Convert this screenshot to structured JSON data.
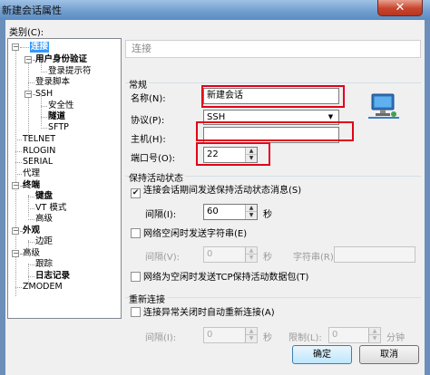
{
  "window": {
    "title": "新建会话属性",
    "close_glyph": "✕"
  },
  "category_label": "类别(C):",
  "tree": {
    "items": [
      {
        "label": "连接",
        "bold": true,
        "selected": true
      },
      {
        "label": "用户身份验证",
        "bold": true
      },
      {
        "label": "登录提示符"
      },
      {
        "label": "登录脚本"
      },
      {
        "label": "SSH"
      },
      {
        "label": "安全性"
      },
      {
        "label": "隧道",
        "bold": true
      },
      {
        "label": "SFTP"
      },
      {
        "label": "TELNET"
      },
      {
        "label": "RLOGIN"
      },
      {
        "label": "SERIAL"
      },
      {
        "label": "代理"
      },
      {
        "label": "终端",
        "bold": true
      },
      {
        "label": "键盘",
        "bold": true
      },
      {
        "label": "VT 模式"
      },
      {
        "label": "高级"
      },
      {
        "label": "外观",
        "bold": true
      },
      {
        "label": "边距"
      },
      {
        "label": "高级"
      },
      {
        "label": "跟踪"
      },
      {
        "label": "日志记录",
        "bold": true
      },
      {
        "label": "ZMODEM"
      }
    ]
  },
  "panel": {
    "title": "连接",
    "general": {
      "group_label": "常规",
      "name_label": "名称(N):",
      "name_value": "新建会话",
      "protocol_label": "协议(P):",
      "protocol_value": "SSH",
      "host_label": "主机(H):",
      "host_value": "",
      "port_label": "端口号(O):",
      "port_value": "22",
      "icon": "network-computer-icon"
    },
    "keepalive": {
      "group_label": "保持活动状态",
      "send_keepalive_label": "连接会话期间发送保持活动状态消息(S)",
      "send_keepalive_checked": true,
      "interval_label": "间隔(I):",
      "interval_value": "60",
      "interval_unit": "秒",
      "send_string_label": "网络空闲时发送字符串(E)",
      "send_string_checked": false,
      "string_interval_label": "间隔(V):",
      "string_interval_value": "0",
      "string_unit": "秒",
      "string_label": "字符串(R):",
      "string_value": "",
      "tcp_keepalive_label": "网络为空闲时发送TCP保持活动数据包(T)",
      "tcp_keepalive_checked": false
    },
    "reconnect": {
      "group_label": "重新连接",
      "auto_reconnect_label": "连接异常关闭时自动重新连接(A)",
      "auto_reconnect_checked": false,
      "interval_label": "间隔(I):",
      "interval_value": "0",
      "interval_unit": "秒",
      "limit_label": "限制(L):",
      "limit_value": "0",
      "limit_unit": "分钟"
    }
  },
  "buttons": {
    "ok": "确定",
    "cancel": "取消"
  },
  "colors": {
    "highlight_box": "#e2001a",
    "selection": "#3399ff"
  }
}
